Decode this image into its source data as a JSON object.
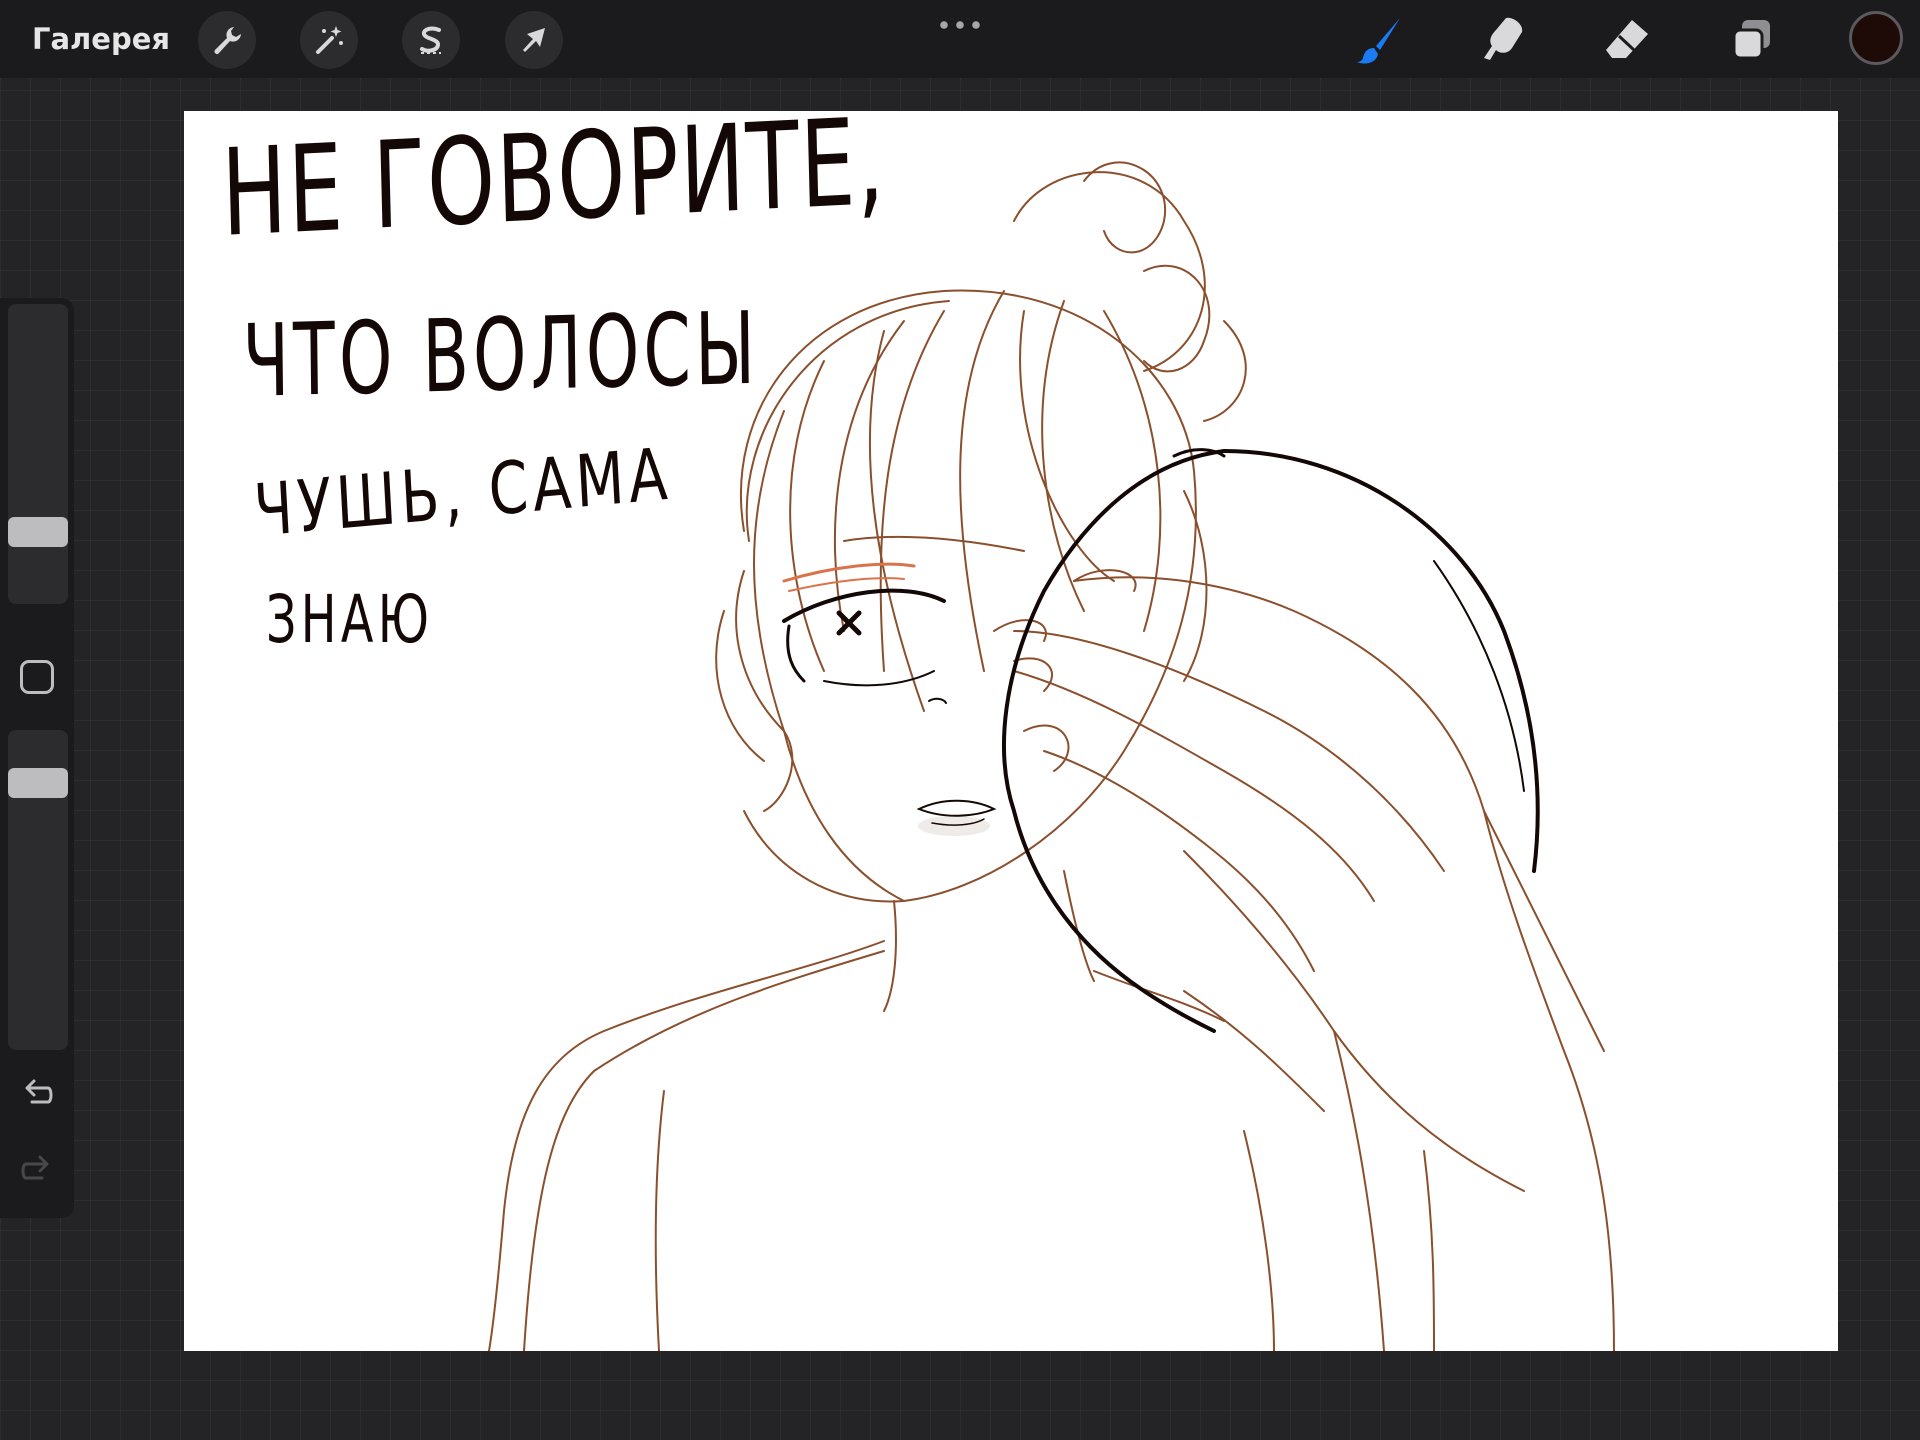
{
  "toolbar": {
    "gallery_label": "Галерея",
    "left_tools": [
      {
        "name": "actions",
        "icon": "wrench-icon"
      },
      {
        "name": "adjustments",
        "icon": "magic-wand-icon"
      },
      {
        "name": "selection",
        "icon": "selection-s-icon"
      },
      {
        "name": "transform",
        "icon": "arrow-cursor-icon"
      }
    ],
    "more_icon": "ellipsis-icon",
    "right_tools": [
      {
        "name": "brush",
        "icon": "brush-icon",
        "active": true
      },
      {
        "name": "smudge",
        "icon": "smudge-finger-icon",
        "active": false
      },
      {
        "name": "eraser",
        "icon": "eraser-icon",
        "active": false
      },
      {
        "name": "layers",
        "icon": "layers-icon",
        "active": false
      }
    ],
    "current_color": "#1e0a06",
    "accent_color": "#1a7cf5"
  },
  "sidebar": {
    "size_slider_level": 0.21,
    "opacity_slider_level": 0.87,
    "modify_icon": "square-modify-icon",
    "undo_icon": "undo-arrow-icon",
    "redo_icon": "redo-arrow-icon"
  },
  "canvas": {
    "background": "#ffffff",
    "ink_color": "#140806",
    "sketch_color": "#8a4f2c",
    "text_lines": [
      "НЕ ГОВОРИТЕ,",
      "ЧТО ВОЛОСЫ",
      "ЧУШЬ, САМА",
      "ЗНАЮ"
    ]
  }
}
